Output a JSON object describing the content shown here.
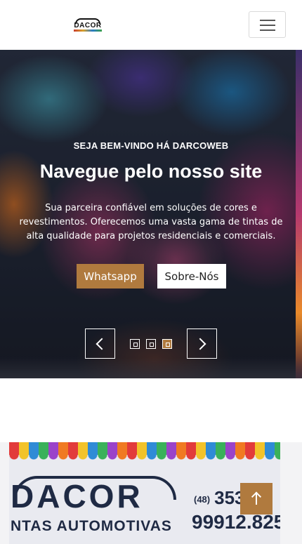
{
  "header": {
    "logo_text": "DACOR",
    "menu_icon": "hamburger-menu-icon"
  },
  "hero": {
    "eyebrow": "SEJA BEM-VINDO HÁ DARCOWEB",
    "headline": "Navegue pelo nosso site",
    "subtext": "Sua parceira confiável em soluções de cores e revestimentos. Oferecemos uma vasta gama de tintas de alta qualidade para projetos residenciais e comerciais.",
    "buttons": {
      "primary_label": "Whatsapp",
      "secondary_label": "Sobre-Nós"
    },
    "carousel": {
      "prev_icon": "chevron-left-icon",
      "next_icon": "chevron-right-icon",
      "slides": 3,
      "active_slide": 3
    }
  },
  "about_image": {
    "brand": "DACOR",
    "tagline": "NTAS AUTOMOTIVAS",
    "phone_area": "(48)",
    "phone_1": "353",
    "phone_2": "99912.825"
  },
  "back_to_top": {
    "icon": "arrow-up-icon"
  },
  "colors": {
    "accent": "#b07a3e",
    "white": "#ffffff",
    "dark_text": "#1f2a44"
  }
}
